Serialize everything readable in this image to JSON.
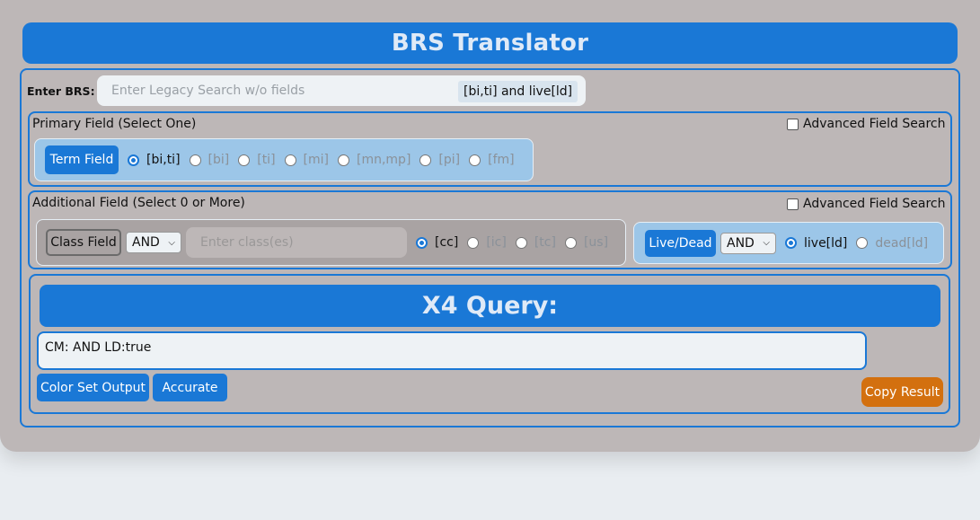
{
  "title": "BRS Translator",
  "brs": {
    "label": "Enter BRS:",
    "placeholder": "Enter Legacy Search w/o fields",
    "chip": "[bi,ti] and live[ld]"
  },
  "primary": {
    "title": "Primary Field (Select One)",
    "advanced_label": "Advanced Field Search",
    "term_button": "Term Field",
    "options": [
      {
        "label": "[bi,ti]",
        "selected": true
      },
      {
        "label": "[bi]",
        "selected": false
      },
      {
        "label": "[ti]",
        "selected": false
      },
      {
        "label": "[mi]",
        "selected": false
      },
      {
        "label": "[mn,mp]",
        "selected": false
      },
      {
        "label": "[pi]",
        "selected": false
      },
      {
        "label": "[fm]",
        "selected": false
      }
    ]
  },
  "additional": {
    "title": "Additional Field (Select 0 or More)",
    "advanced_label": "Advanced Field Search",
    "class_button": "Class Field",
    "class_operator": "AND",
    "class_placeholder": "Enter class(es)",
    "class_options": [
      {
        "label": "[cc]",
        "selected": true
      },
      {
        "label": "[ic]",
        "selected": false
      },
      {
        "label": "[tc]",
        "selected": false
      },
      {
        "label": "[us]",
        "selected": false
      }
    ],
    "live_button": "Live/Dead",
    "live_operator": "AND",
    "live_options": [
      {
        "label": "live[ld]",
        "selected": true
      },
      {
        "label": "dead[ld]",
        "selected": false
      }
    ]
  },
  "query": {
    "heading": "X4 Query:",
    "result": "CM: AND LD:true",
    "color_set_button": "Color Set Output",
    "accurate_button": "Accurate",
    "copy_button": "Copy Result"
  },
  "colors": {
    "accent": "#1a78d6",
    "app_bg": "#bdb7b7",
    "copy": "#d3700f"
  }
}
